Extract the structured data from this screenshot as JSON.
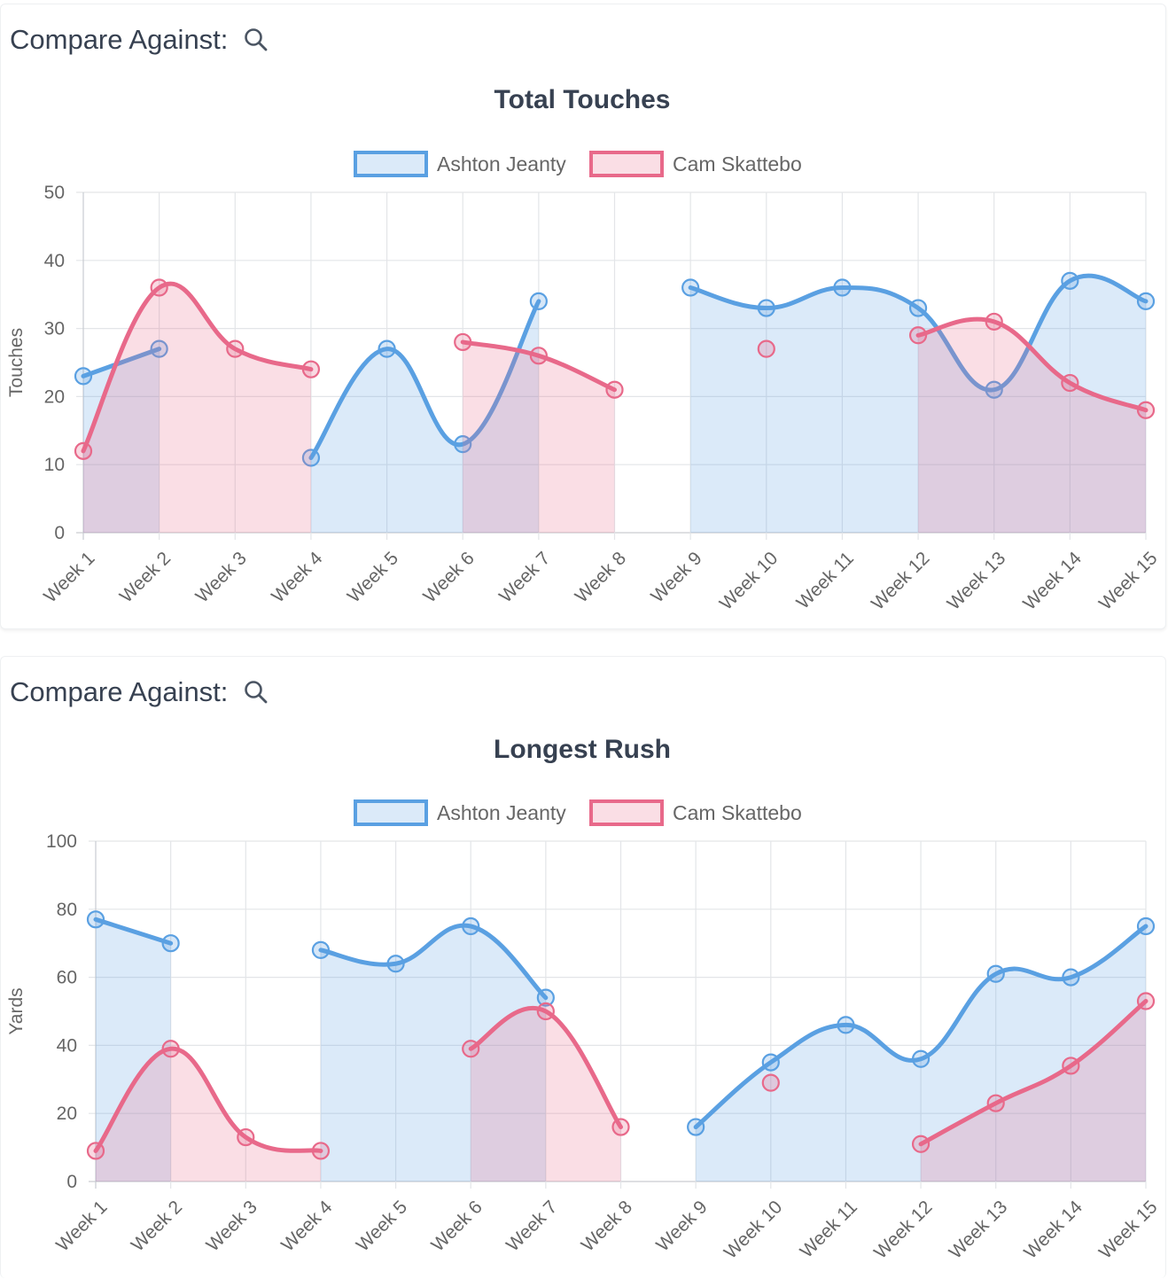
{
  "compare_label": "Compare Against:",
  "icons": {
    "search": "search-icon"
  },
  "chart_data": [
    {
      "type": "line",
      "title": "Total Touches",
      "ylabel": "Touches",
      "ylim": [
        0,
        50
      ],
      "yticks": [
        0,
        10,
        20,
        30,
        40,
        50
      ],
      "grid": true,
      "legend_position": "top",
      "categories": [
        "Week 1",
        "Week 2",
        "Week 3",
        "Week 4",
        "Week 5",
        "Week 6",
        "Week 7",
        "Week 8",
        "Week 9",
        "Week 10",
        "Week 11",
        "Week 12",
        "Week 13",
        "Week 14",
        "Week 15"
      ],
      "series": [
        {
          "name": "Ashton Jeanty",
          "color": "#5aa0e2",
          "fill": "#dbeafa",
          "values": [
            23,
            27,
            null,
            11,
            27,
            13,
            34,
            null,
            36,
            33,
            36,
            33,
            21,
            37,
            34
          ]
        },
        {
          "name": "Cam Skattebo",
          "color": "#e8698a",
          "fill": "#fbe1e6",
          "values": [
            12,
            36,
            27,
            24,
            null,
            28,
            26,
            21,
            null,
            27,
            null,
            29,
            31,
            22,
            18
          ]
        }
      ]
    },
    {
      "type": "line",
      "title": "Longest Rush",
      "ylabel": "Yards",
      "ylim": [
        0,
        100
      ],
      "yticks": [
        0,
        20,
        40,
        60,
        80,
        100
      ],
      "grid": true,
      "legend_position": "top",
      "categories": [
        "Week 1",
        "Week 2",
        "Week 3",
        "Week 4",
        "Week 5",
        "Week 6",
        "Week 7",
        "Week 8",
        "Week 9",
        "Week 10",
        "Week 11",
        "Week 12",
        "Week 13",
        "Week 14",
        "Week 15"
      ],
      "series": [
        {
          "name": "Ashton Jeanty",
          "color": "#5aa0e2",
          "fill": "#dbeafa",
          "values": [
            77,
            70,
            null,
            68,
            64,
            75,
            54,
            null,
            16,
            35,
            46,
            36,
            61,
            60,
            75
          ]
        },
        {
          "name": "Cam Skattebo",
          "color": "#e8698a",
          "fill": "#fbe1e6",
          "values": [
            9,
            39,
            13,
            9,
            null,
            39,
            50,
            16,
            null,
            29,
            null,
            11,
            23,
            34,
            53
          ]
        }
      ]
    }
  ]
}
